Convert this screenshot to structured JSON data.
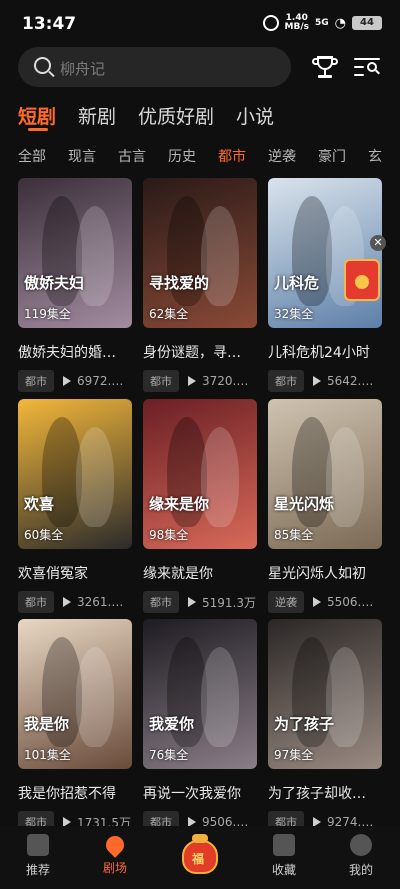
{
  "status_bar": {
    "time": "13:47",
    "speed_value": "1.40",
    "speed_unit": "MB/s",
    "signal": "5G",
    "battery": "44"
  },
  "search": {
    "placeholder": "柳舟记"
  },
  "tabs": [
    {
      "label": "短剧",
      "active": true
    },
    {
      "label": "新剧",
      "active": false
    },
    {
      "label": "优质好剧",
      "active": false
    },
    {
      "label": "小说",
      "active": false
    }
  ],
  "categories": [
    {
      "label": "全部",
      "active": false
    },
    {
      "label": "现言",
      "active": false
    },
    {
      "label": "古言",
      "active": false
    },
    {
      "label": "历史",
      "active": false
    },
    {
      "label": "都市",
      "active": true
    },
    {
      "label": "逆袭",
      "active": false
    },
    {
      "label": "豪门",
      "active": false
    },
    {
      "label": "玄",
      "active": false
    }
  ],
  "dramas": [
    {
      "title": "傲娇夫妇的婚…",
      "episodes": "119集全",
      "tag": "都市",
      "views": "6972.…",
      "art_text": "傲娇夫妇",
      "color_a": "#3b2f3a",
      "color_b": "#a28ca0"
    },
    {
      "title": "身份谜题，寻…",
      "episodes": "62集全",
      "tag": "都市",
      "views": "3720.…",
      "art_text": "寻找爱的",
      "color_a": "#2a1a18",
      "color_b": "#8a4a36"
    },
    {
      "title": "儿科危机24小时",
      "episodes": "32集全",
      "tag": "都市",
      "views": "5642.…",
      "art_text": "儿科危",
      "color_a": "#d9e3ec",
      "color_b": "#5d7fa8"
    },
    {
      "title": "欢喜俏冤家",
      "episodes": "60集全",
      "tag": "都市",
      "views": "3261.…",
      "art_text": "欢喜",
      "color_a": "#f3b73a",
      "color_b": "#2b2b2b"
    },
    {
      "title": "缘来就是你",
      "episodes": "98集全",
      "tag": "都市",
      "views": "5191.3万",
      "art_text": "缘来是你",
      "color_a": "#6b1f24",
      "color_b": "#d86a5a"
    },
    {
      "title": "星光闪烁人如初",
      "episodes": "85集全",
      "tag": "逆袭",
      "views": "5506.…",
      "art_text": "星光闪烁",
      "color_a": "#cfc3b0",
      "color_b": "#7b6a55"
    },
    {
      "title": "我是你招惹不得",
      "episodes": "101集全",
      "tag": "都市",
      "views": "1731.5万",
      "art_text": "我是你",
      "color_a": "#e8d7c4",
      "color_b": "#6a4b3a"
    },
    {
      "title": "再说一次我爱你",
      "episodes": "76集全",
      "tag": "都市",
      "views": "9506.…",
      "art_text": "我爱你",
      "color_a": "#1e1b22",
      "color_b": "#8b7e88"
    },
    {
      "title": "为了孩子却收…",
      "episodes": "97集全",
      "tag": "都市",
      "views": "9274.…",
      "art_text": "为了孩子",
      "color_a": "#2b2726",
      "color_b": "#9a8b82"
    }
  ],
  "bottom_nav": [
    {
      "label": "推荐",
      "active": false
    },
    {
      "label": "剧场",
      "active": true
    },
    {
      "label": "收藏",
      "active": false
    },
    {
      "label": "我的",
      "active": false
    }
  ],
  "center_bag_char": "福"
}
